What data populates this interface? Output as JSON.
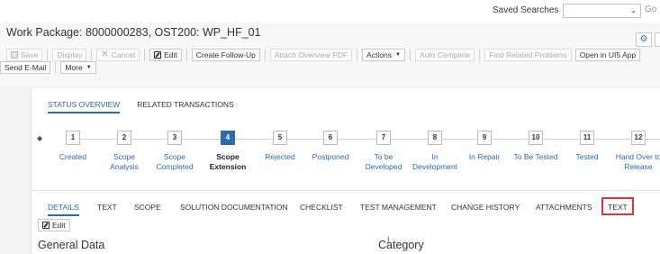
{
  "topbar": {
    "saved_searches": "Saved Searches",
    "go": "Go"
  },
  "header": {
    "title": "Work Package: 8000000283, OST200: WP_HF_01"
  },
  "toolbar": {
    "save": "Save",
    "display": "Display",
    "cancel": "Cancel",
    "edit": "Edit",
    "create_follow_up": "Create Follow-Up",
    "attach_overview_pdf": "Attach Overview PDF",
    "actions": "Actions",
    "auto_complete": "Auto Complete",
    "find_related_problems": "Find Related Problems",
    "open_in_ui5_app": "Open in UI5 App",
    "send_email": "Send E-Mail",
    "more": "More"
  },
  "overview_tabs": [
    "STATUS OVERVIEW",
    "RELATED TRANSACTIONS"
  ],
  "steps": [
    {
      "number": "1",
      "label": "Created"
    },
    {
      "number": "2",
      "label": "Scope\nAnalysis"
    },
    {
      "number": "3",
      "label": "Scope\nCompleted"
    },
    {
      "number": "4",
      "label": "Scope\nExtension",
      "current": true
    },
    {
      "number": "5",
      "label": "Rejected"
    },
    {
      "number": "6",
      "label": "Postponed"
    },
    {
      "number": "7",
      "label": "To be\nDeveloped"
    },
    {
      "number": "8",
      "label": "In\nDevelopment"
    },
    {
      "number": "9",
      "label": "In Repair"
    },
    {
      "number": "10",
      "label": "To Be Tested"
    },
    {
      "number": "11",
      "label": "Tested"
    },
    {
      "number": "12",
      "label": "Hand Over to\nRelease"
    }
  ],
  "detail_tabs": [
    "DETAILS",
    "TEXT",
    "SCOPE",
    "SOLUTION DOCUMENTATION",
    "CHECKLIST",
    "TEST MANAGEMENT",
    "CHANGE HISTORY",
    "ATTACHMENTS",
    "TEXT"
  ],
  "details": {
    "edit": "Edit",
    "general_data": "General Data",
    "category": "Category"
  },
  "colors": {
    "accent": "#2c6aa8",
    "highlight": "#d9363e"
  }
}
